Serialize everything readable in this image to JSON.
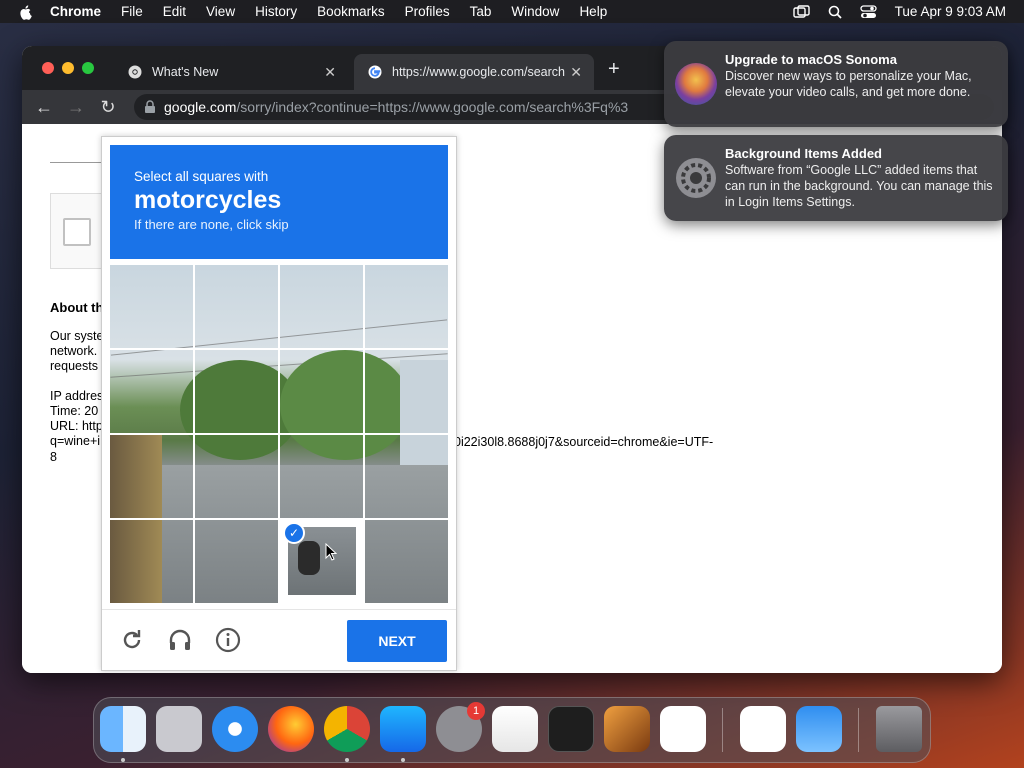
{
  "menubar": {
    "items": [
      "Chrome",
      "File",
      "Edit",
      "View",
      "History",
      "Bookmarks",
      "Profiles",
      "Tab",
      "Window",
      "Help"
    ],
    "datetime": "Tue Apr 9  9:03 AM"
  },
  "tabs": [
    {
      "title": "What's New"
    },
    {
      "title": "https://www.google.com/search"
    }
  ],
  "address_bar": {
    "host": "google.com",
    "path": "/sorry/index?continue=https://www.google.com/search%3Fq%3"
  },
  "page": {
    "about": "About th",
    "p1": [
      "Our syste",
      "network.",
      "requests"
    ],
    "p2": [
      "IP addres",
      "Time: 20",
      "URL: http",
      "q=wine+i"
    ],
    "url_tail": "0i22i30l8.8688j0j7&sourceid=chrome&ie=UTF-",
    "url_end": "8"
  },
  "captcha": {
    "line1": "Select all squares with",
    "target": "motorcycles",
    "line3": "If there are none, click skip",
    "selected_tiles": [
      14
    ],
    "next_label": "NEXT"
  },
  "notifications": [
    {
      "title": "Upgrade to macOS Sonoma",
      "body": "Discover new ways to personalize your Mac, elevate your video calls, and get more done."
    },
    {
      "title": "Background Items Added",
      "body": "Software from “Google LLC” added items that can run in the background. You can manage this in Login Items Settings."
    }
  ],
  "dock": {
    "badge": "1"
  }
}
